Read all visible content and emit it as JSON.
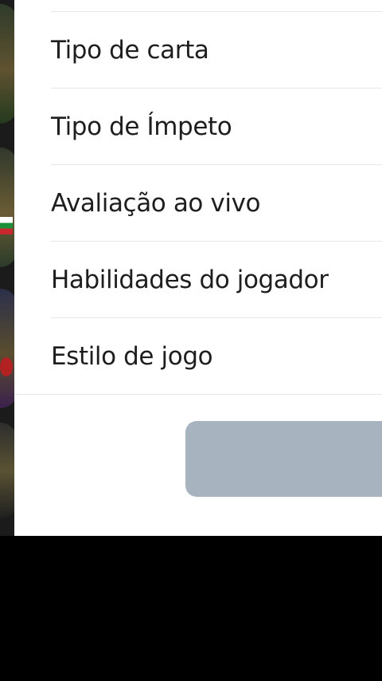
{
  "filter_sheet": {
    "options": [
      {
        "label": "Tipo de carta"
      },
      {
        "label": "Tipo de Ímpeto"
      },
      {
        "label": "Avaliação ao vivo"
      },
      {
        "label": "Habilidades do jogador"
      },
      {
        "label": "Estilo de jogo"
      }
    ],
    "apply_button": {
      "label": "",
      "state": "disabled"
    }
  },
  "colors": {
    "sheet_background": "#ffffff",
    "divider": "#e6e6e6",
    "disabled_button": "#a7b3bf",
    "text": "#1e1e1e"
  }
}
